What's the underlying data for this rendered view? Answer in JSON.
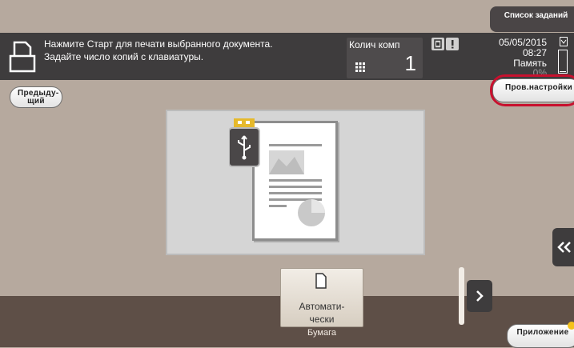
{
  "status": {
    "message_line1": "Нажмите Старт для печати выбранного документа.",
    "message_line2": "Задайте число копий с клавиатуры."
  },
  "copies": {
    "label": "Колич комп",
    "value": "1"
  },
  "datetime": {
    "date": "05/05/2015",
    "time": "08:27",
    "memory_label": "Память",
    "memory_pct": "0%"
  },
  "buttons": {
    "job_list": "Список заданий",
    "previous": "Предыду-щий",
    "check_settings": "Пров.настройки",
    "applications": "Приложение"
  },
  "paper": {
    "button_label": "Автомати-чески",
    "caption": "Бумага"
  },
  "icons": {
    "document": "document-icon",
    "usb": "usb-memory-icon",
    "keypad": "keypad-icon",
    "next": "chevron-right-icon",
    "side_panel": "double-chevron-left-icon"
  },
  "colors": {
    "highlight_ring": "#c8102e",
    "app_badge": "#f5c21b"
  }
}
